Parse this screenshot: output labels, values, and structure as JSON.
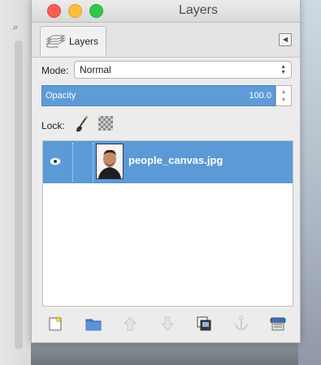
{
  "window": {
    "title": "Layers"
  },
  "tabs": [
    {
      "label": "Layers"
    }
  ],
  "mode": {
    "label": "Mode:",
    "value": "Normal"
  },
  "opacity": {
    "label": "Opacity",
    "value": "100.0",
    "percent": 100
  },
  "lock": {
    "label": "Lock:"
  },
  "layers": [
    {
      "name": "people_canvas.jpg",
      "visible": true,
      "selected": true
    }
  ],
  "toolbar": {
    "buttons": [
      {
        "name": "new-layer",
        "icon": "new-layer-icon",
        "enabled": true
      },
      {
        "name": "new-layer-group",
        "icon": "folder-icon",
        "enabled": true
      },
      {
        "name": "raise-layer",
        "icon": "arrow-up-icon",
        "enabled": false
      },
      {
        "name": "lower-layer",
        "icon": "arrow-down-icon",
        "enabled": false
      },
      {
        "name": "duplicate-layer",
        "icon": "duplicate-icon",
        "enabled": true
      },
      {
        "name": "anchor-layer",
        "icon": "anchor-icon",
        "enabled": false
      },
      {
        "name": "delete-layer",
        "icon": "delete-icon",
        "enabled": true
      }
    ]
  },
  "colors": {
    "selection": "#5b9ad6",
    "opacity_fill": "#5e9bd7"
  }
}
